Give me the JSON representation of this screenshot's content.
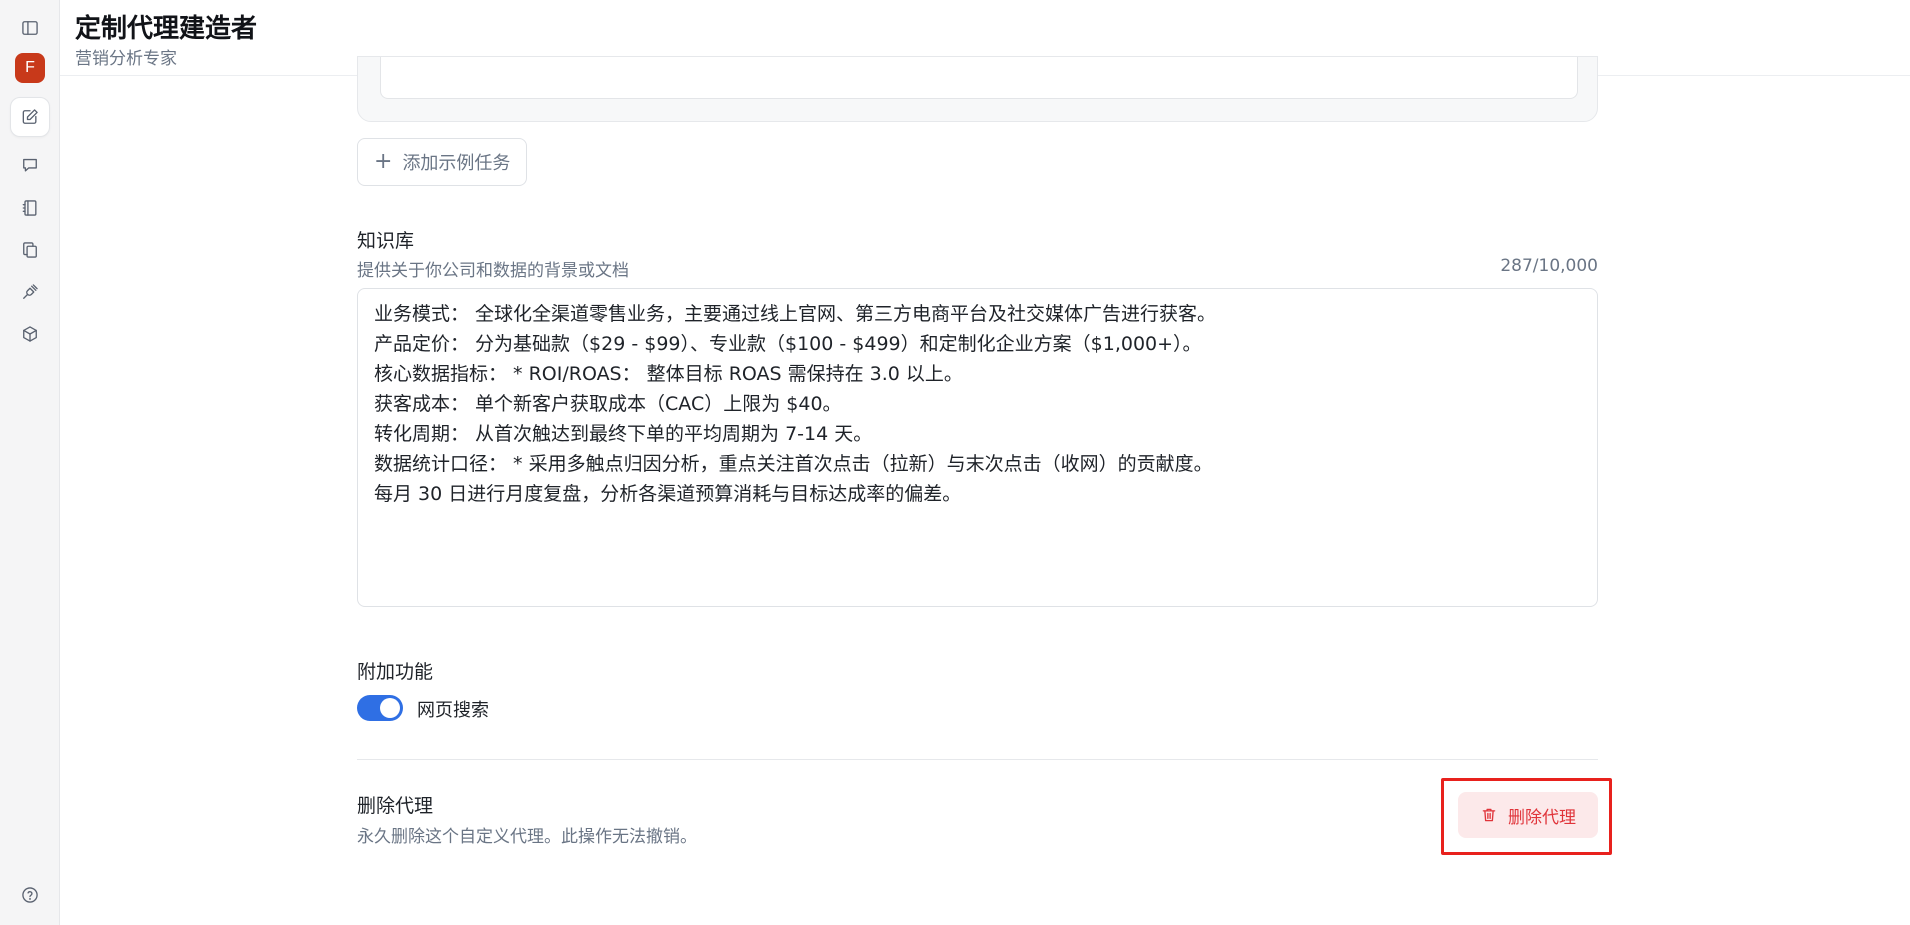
{
  "header": {
    "title": "定制代理建造者",
    "subtitle": "营销分析专家"
  },
  "sidebar": {
    "avatar_letter": "F",
    "avatar_color": "#c8391a",
    "items": [
      {
        "icon": "sidebar-toggle-icon"
      },
      {
        "icon": "edit-icon",
        "active": true
      },
      {
        "icon": "chat-icon"
      },
      {
        "icon": "notebook-icon"
      },
      {
        "icon": "copy-icon"
      },
      {
        "icon": "plug-icon"
      },
      {
        "icon": "cube-icon"
      },
      {
        "icon": "help-icon"
      }
    ]
  },
  "examples": {
    "add_label": "添加示例任务"
  },
  "knowledge": {
    "label": "知识库",
    "hint": "提供关于你公司和数据的背景或文档",
    "count": "287/10,000",
    "lines": [
      "业务模式： 全球化全渠道零售业务，主要通过线上官网、第三方电商平台及社交媒体广告进行获客。",
      "产品定价： 分为基础款（$29 - $99）、专业款（$100 - $499）和定制化企业方案（$1,000+）。",
      "核心数据指标： * ROI/ROAS： 整体目标 ROAS 需保持在 3.0 以上。",
      "获客成本： 单个新客户获取成本（CAC）上限为 $40。",
      "转化周期： 从首次触达到最终下单的平均周期为 7-14 天。",
      "数据统计口径： * 采用多触点归因分析，重点关注首次点击（拉新）与末次点击（收网）的贡献度。",
      "每月 30 日进行月度复盘，分析各渠道预算消耗与目标达成率的偏差。"
    ]
  },
  "addons": {
    "label": "附加功能",
    "web_search_label": "网页搜索",
    "web_search_enabled": true,
    "toggle_color": "#2f6fe4"
  },
  "danger": {
    "title": "删除代理",
    "description": "永久删除这个自定义代理。此操作无法撤销。",
    "button_label": "删除代理",
    "button_color": "#e0343a",
    "highlight_color": "#e8211d"
  }
}
